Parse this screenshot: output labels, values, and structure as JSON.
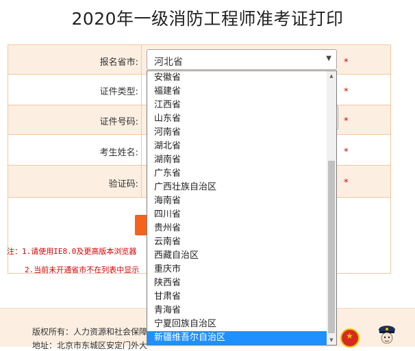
{
  "page": {
    "title": "2020年一级消防工程师准考证打印"
  },
  "form": {
    "fields": [
      {
        "label": "报名省市:"
      },
      {
        "label": "证件类型:"
      },
      {
        "label": "证件号码:"
      },
      {
        "label": "考生姓名:"
      },
      {
        "label": "验证码:"
      }
    ],
    "required_mark": "*",
    "province_select": {
      "value": "河北省",
      "options": [
        "安徽省",
        "福建省",
        "江西省",
        "山东省",
        "河南省",
        "湖北省",
        "湖南省",
        "广东省",
        "广西壮族自治区",
        "海南省",
        "四川省",
        "贵州省",
        "云南省",
        "西藏自治区",
        "重庆市",
        "陕西省",
        "甘肃省",
        "青海省",
        "宁夏回族自治区",
        "新疆维吾尔自治区"
      ],
      "highlighted": "新疆维吾尔自治区"
    }
  },
  "notes": {
    "line1": "注：1.请使用IE8.0及更高版本浏览器",
    "line2": "2.当前未开通省市不在列表中显示"
  },
  "footer": {
    "copyright": "版权所有：人力资源和社会保障",
    "address": "地址：北京市东城区安定门外大"
  },
  "colors": {
    "accent": "#f5621c",
    "highlight": "#1e90ff",
    "row_bg": "#fcefe2",
    "required": "#e00000"
  },
  "icons": [
    "chevron-down-icon",
    "scroll-up-arrow-icon",
    "scroll-down-arrow-icon",
    "national-emblem-icon",
    "police-mascot-icon"
  ]
}
